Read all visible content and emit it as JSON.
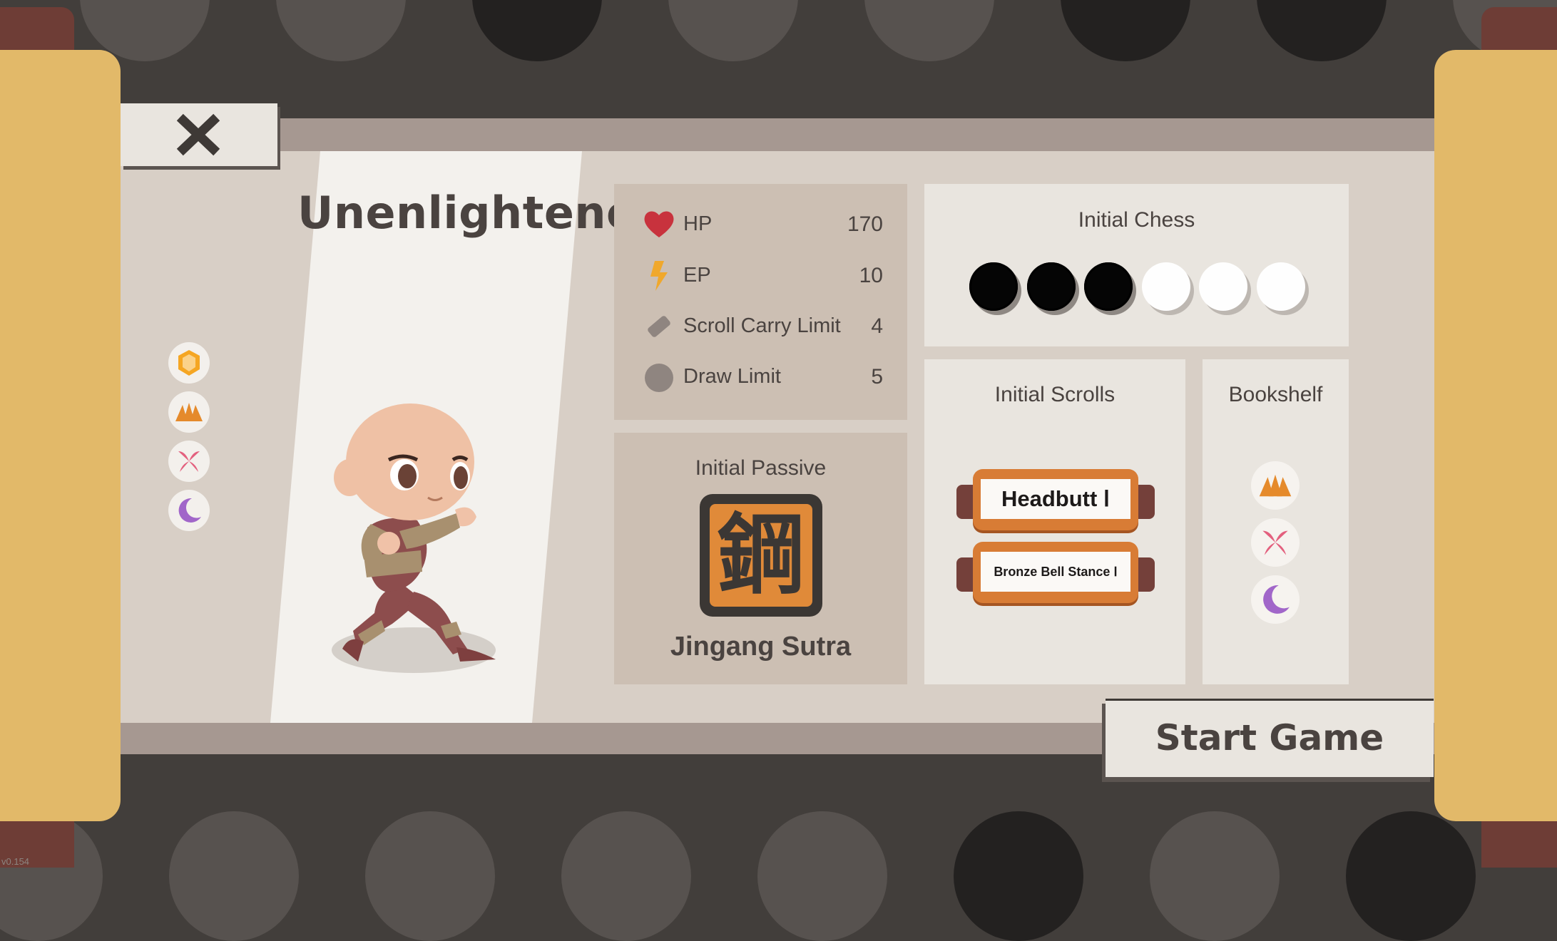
{
  "character": {
    "name": "Unenlightened"
  },
  "close_button": {
    "icon": "close-icon"
  },
  "factions": [
    {
      "icon": "hexagon-icon",
      "color": "#f5a623"
    },
    {
      "icon": "mountain-icon",
      "color": "#e58a2b"
    },
    {
      "icon": "butterfly-icon",
      "color": "#e3607e"
    },
    {
      "icon": "moon-icon",
      "color": "#a166c9"
    }
  ],
  "stats": [
    {
      "icon": "heart-icon",
      "label": "HP",
      "value": "170"
    },
    {
      "icon": "lightning-icon",
      "label": "EP",
      "value": "10"
    },
    {
      "icon": "scroll-icon",
      "label": "Scroll Carry Limit",
      "value": "4"
    },
    {
      "icon": "circle-icon",
      "label": "Draw Limit",
      "value": "5"
    }
  ],
  "initial_passive": {
    "title": "Initial Passive",
    "name": "Jingang Sutra",
    "glyph": "鋼"
  },
  "initial_chess": {
    "title": "Initial Chess",
    "stones": [
      "black",
      "black",
      "black",
      "white",
      "white",
      "white"
    ]
  },
  "initial_scrolls": {
    "title": "Initial Scrolls",
    "items": [
      {
        "label": "Headbutt Ⅰ"
      },
      {
        "label": "Bronze Bell Stance Ⅰ"
      }
    ]
  },
  "bookshelf": {
    "title": "Bookshelf",
    "icons": [
      "mountain-icon",
      "butterfly-icon",
      "moon-icon"
    ]
  },
  "start_button": {
    "label": "Start Game"
  },
  "version": "v0.154",
  "colors": {
    "board": "#d8cfc6",
    "accent": "#e2b969",
    "stone_black": "#050505",
    "stone_white": "#fefefe"
  }
}
